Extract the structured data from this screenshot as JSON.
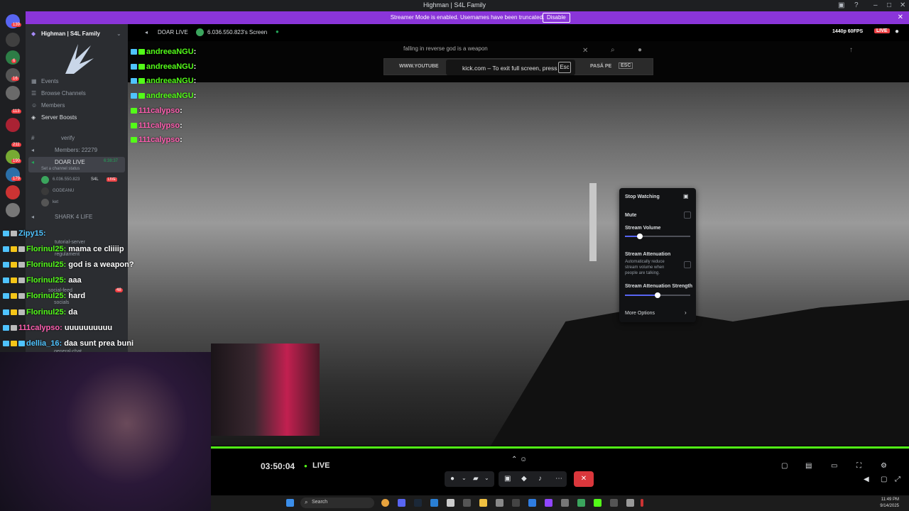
{
  "window": {
    "title": "Highman | S4L Family"
  },
  "banner": {
    "message": "Streamer Mode is enabled. Usernames have been truncated.",
    "disable_label": "Disable"
  },
  "rail": {
    "badges": [
      "139",
      "6",
      "16",
      "113",
      "211",
      "190",
      "179"
    ]
  },
  "sidebar": {
    "server_name": "Highman | S4L Family",
    "items": [
      {
        "label": "Events"
      },
      {
        "label": "Browse Channels"
      },
      {
        "label": "Members"
      },
      {
        "label": "Server Boosts"
      }
    ],
    "channels": {
      "verify": "verify",
      "members_count": "Members: 22279",
      "doar_live": "DOAR LIVE",
      "doar_live_time": "6:38:37",
      "channel_status": "Set a channel status",
      "live_user": "6.036.550.823",
      "live_user_tag": "S4L",
      "live_badge": "LIVE",
      "user2": "GODEANU",
      "user3": "ket",
      "shark": "SHARK 4 LIFE",
      "tutorial": "tutorial-server",
      "regulament": "regulament",
      "social_feed": "social-feed",
      "social_feed_badge": "48",
      "socials": "socials",
      "general_chat": "general-chat"
    }
  },
  "stream_header": {
    "channel": "DOAR LIVE",
    "streamer": "6.036.550.823's Screen",
    "quality": "1440p 60FPS",
    "live": "LIVE"
  },
  "browser": {
    "search_text": "falling in reverse god is a weapon",
    "fullscreen_notice": "kick.com – To exit full screen, press",
    "esc_key": "Esc",
    "left_text": "WWW.YOUTUBE",
    "right_text": "PASĂ PE",
    "esc_key2": "ESC"
  },
  "chat_top": [
    {
      "name": "andreeaNGU",
      "sep": ":"
    },
    {
      "name": "andreeaNGU",
      "sep": ":"
    },
    {
      "name": "andreeaNGU",
      "sep": ":"
    },
    {
      "name": "andreeaNGU",
      "sep": ":"
    },
    {
      "name": "111calypso",
      "sep": ":"
    },
    {
      "name": "111calypso",
      "sep": ":"
    },
    {
      "name": "111calypso",
      "sep": ":"
    }
  ],
  "chat_bottom": [
    {
      "name": "Zipy15:",
      "message": ""
    },
    {
      "name": "Florinul25:",
      "message": "mama ce cliiiip"
    },
    {
      "name": "Florinul25:",
      "message": "god is a weapon?"
    },
    {
      "name": "Florinul25:",
      "message": "aaa"
    },
    {
      "name": "Florinul25:",
      "message": "hard"
    },
    {
      "name": "Florinul25:",
      "message": "da"
    },
    {
      "name": "111calypso:",
      "message": "uuuuuuuuuu"
    },
    {
      "name": "dellia_16:",
      "message": "daa sunt prea buni"
    }
  ],
  "popout": {
    "stop_watching": "Stop Watching",
    "mute": "Mute",
    "stream_volume": "Stream Volume",
    "stream_volume_level": 0.23,
    "attenuation": "Stream Attenuation",
    "attenuation_desc": "Automatically reduce stream volume when people are talking.",
    "attenuation_strength": "Stream Attenuation Strength",
    "attenuation_strength_level": 0.5,
    "more_options": "More Options"
  },
  "player": {
    "time": "03:50:04",
    "live": "LIVE"
  },
  "taskbar": {
    "search": "Search",
    "time": "11:49 PM",
    "date": "9/14/2025"
  },
  "colors": {
    "accent": "#8a35d9",
    "kick_green": "#53fc18",
    "discord_blurple": "#5865f2",
    "danger": "#da373c"
  }
}
